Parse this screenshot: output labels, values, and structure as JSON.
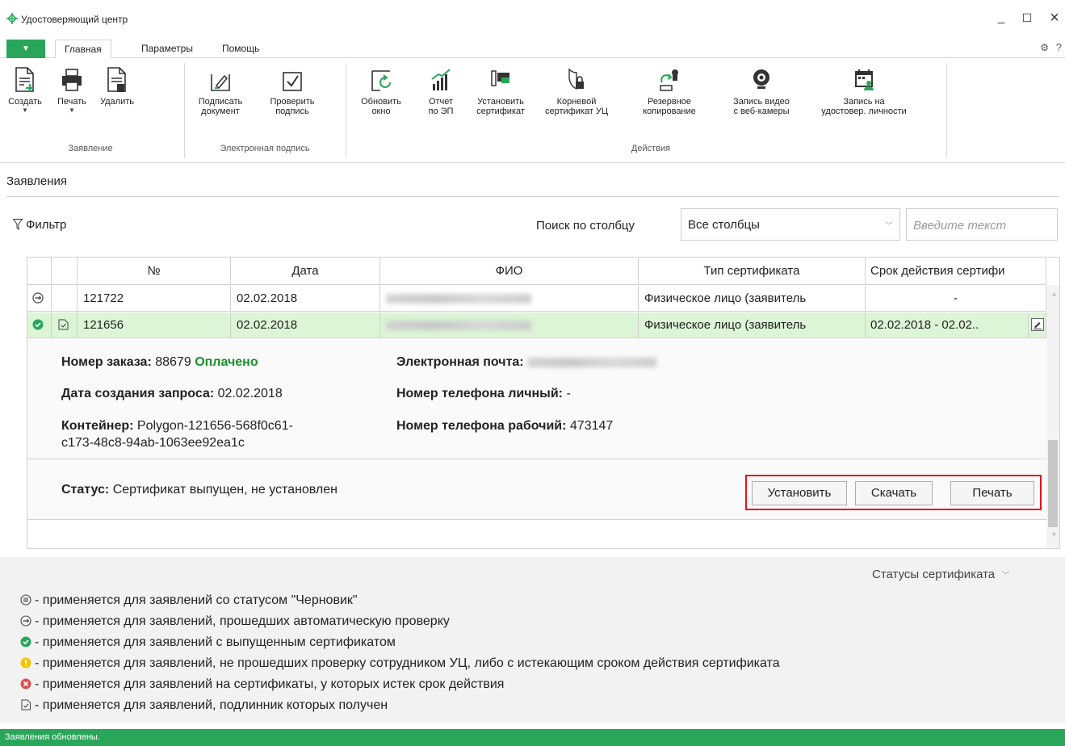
{
  "window": {
    "title": "Удостоверяющий центр",
    "min": "_",
    "max": "☐",
    "close": "×"
  },
  "tabs": {
    "dropdown": "▼",
    "items": [
      "Главная",
      "Параметры",
      "Помощь"
    ],
    "active": "Главная"
  },
  "ribbon": {
    "groups": [
      {
        "label": "Заявление"
      },
      {
        "label": "Электронная подпись"
      },
      {
        "label": "Действия"
      }
    ],
    "buttons": {
      "create": {
        "line1": "Создать",
        "line2": ""
      },
      "print": {
        "line1": "Печать",
        "line2": ""
      },
      "delete": {
        "line1": "Удалить",
        "line2": ""
      },
      "sign": {
        "line1": "Подписать",
        "line2": "документ"
      },
      "verify": {
        "line1": "Проверить",
        "line2": "подпись"
      },
      "refresh": {
        "line1": "Обновить",
        "line2": "окно"
      },
      "report": {
        "line1": "Отчет",
        "line2": "по ЭП"
      },
      "install": {
        "line1": "Установить",
        "line2": "сертификат"
      },
      "root": {
        "line1": "Корневой",
        "line2": "сертификат УЦ"
      },
      "backup": {
        "line1": "Резервное",
        "line2": "копирование"
      },
      "video": {
        "line1": "Запись видео",
        "line2": "с веб-камеры"
      },
      "id_record": {
        "line1": "Запись на",
        "line2": "удостовер. личности"
      }
    }
  },
  "section": {
    "title": "Заявления"
  },
  "filter": {
    "label": "Фильтр",
    "search_label": "Поиск по столбцу",
    "search_scope": "Все столбцы",
    "search_placeholder": "Введите текст"
  },
  "table": {
    "columns": [
      "",
      "",
      "№",
      "Дата",
      "ФИО",
      "Тип сертификата",
      "Срок действия сертифи"
    ],
    "rows": [
      {
        "num": "121722",
        "date": "02.02.2018",
        "type": "Физическое лицо (заявитель",
        "validity": "-"
      },
      {
        "num": "121656",
        "date": "02.02.2018",
        "type": "Физическое лицо (заявитель",
        "validity": "02.02.2018  -  02.02.."
      }
    ]
  },
  "details": {
    "order_label": "Номер заказа:",
    "order_value": "88679",
    "order_status": "Оплачено",
    "created_label": "Дата создания запроса:",
    "created_value": "02.02.2018",
    "container_label": "Контейнер:",
    "container_value_1": "Polygon-121656-568f0c61-",
    "container_value_2": "c173-48c8-94ab-1063ee92ea1c",
    "email_label": "Электронная почта:",
    "phone_personal_label": "Номер телефона личный:",
    "phone_personal_value": "-",
    "phone_work_label": "Номер телефона рабочий:",
    "phone_work_value": "473147",
    "status_label": "Статус:",
    "status_value": "Сертификат выпущен, не установлен",
    "btn_install": "Установить",
    "btn_download": "Скачать",
    "btn_print": "Печать"
  },
  "legend": {
    "toggle": "Статусы сертификата",
    "items": [
      "- применяется для заявлений со статусом \"Черновик\"",
      "- применяется для заявлений, прошедших автоматическую проверку",
      "- применяется для заявлений с выпущенным сертификатом",
      "- применяется для заявлений, не прошедших проверку сотрудником УЦ, либо с истекающим сроком действия сертификата",
      "- применяется для заявлений на сертификаты, у которых истек срок действия",
      "- применяется для заявлений, подлинник которых получен"
    ]
  },
  "statusbar": {
    "text": "Заявления обновлены."
  },
  "colors": {
    "accent": "#2aa65a",
    "selected_row": "#dcf5d6",
    "highlight_frame": "#e2141c",
    "paid": "#1a8c2c"
  }
}
